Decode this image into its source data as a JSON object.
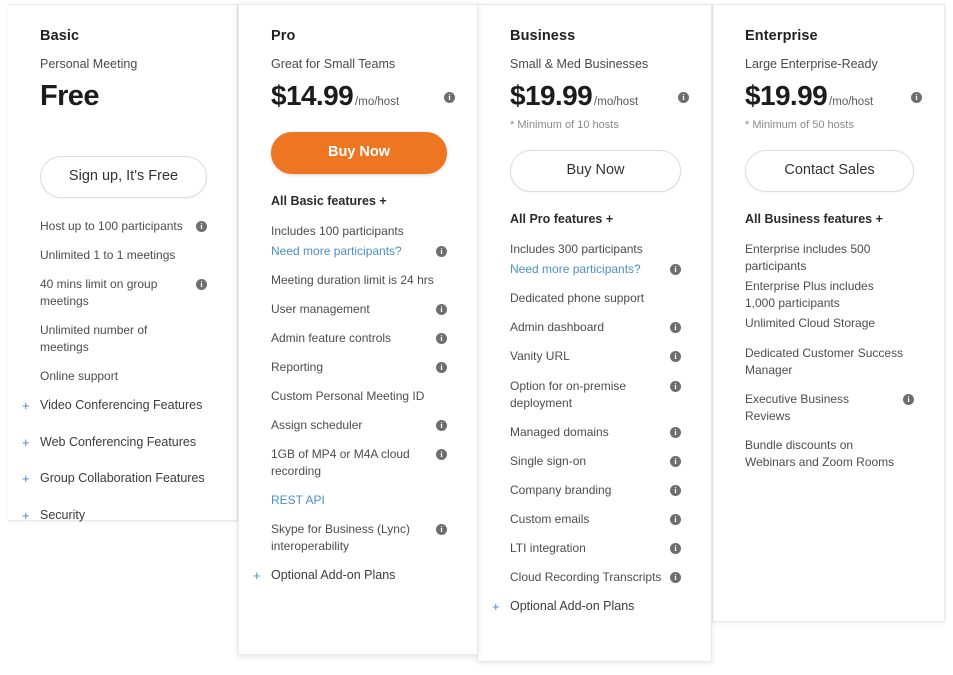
{
  "colors": {
    "accent_orange": "#ee7623",
    "link_blue": "#4c8fc4",
    "plus_blue": "#4a86c8",
    "card_border": "#e9e9e9"
  },
  "icons": {
    "info": "i",
    "plus": "+"
  },
  "plans": [
    {
      "name": "Basic",
      "tagline": "Personal Meeting",
      "price": "Free",
      "price_unit": "",
      "price_note": "",
      "has_price_info": false,
      "cta": {
        "label": "Sign up, It's Free",
        "style": "outline"
      },
      "features_head": "",
      "features": [
        {
          "text": "Host up to 100 participants",
          "info": true
        },
        {
          "text": "Unlimited 1 to 1 meetings",
          "info": false
        },
        {
          "text": "40 mins limit on group meetings",
          "info": true
        },
        {
          "text": "Unlimited number of meetings",
          "info": false
        },
        {
          "text": "Online support",
          "info": false
        }
      ],
      "expanders": [
        "Video Conferencing Features",
        "Web Conferencing Features",
        "Group Collaboration Features",
        "Security"
      ]
    },
    {
      "name": "Pro",
      "tagline": "Great for Small Teams",
      "price": "$14.99",
      "price_unit": "/mo/host",
      "price_note": "",
      "has_price_info": true,
      "cta": {
        "label": "Buy Now",
        "style": "solid"
      },
      "features_head": "All Basic features +",
      "features": [
        {
          "text": "Includes 100 participants",
          "info": false,
          "tight": true
        },
        {
          "text": "Need more participants?",
          "info": true,
          "link": true
        },
        {
          "text": "Meeting duration limit is 24 hrs",
          "info": false
        },
        {
          "text": "User management",
          "info": true
        },
        {
          "text": "Admin feature controls",
          "info": true
        },
        {
          "text": "Reporting",
          "info": true
        },
        {
          "text": "Custom Personal Meeting ID",
          "info": false
        },
        {
          "text": "Assign scheduler",
          "info": true
        },
        {
          "text": "1GB of MP4 or M4A cloud recording",
          "info": true
        },
        {
          "text": "REST API",
          "info": false,
          "link": true
        },
        {
          "text": "Skype for Business (Lync) interoperability",
          "info": true
        }
      ],
      "expanders": [
        "Optional Add-on Plans"
      ]
    },
    {
      "name": "Business",
      "tagline": "Small & Med Businesses",
      "price": "$19.99",
      "price_unit": "/mo/host",
      "price_note": "* Minimum of 10 hosts",
      "has_price_info": true,
      "cta": {
        "label": "Buy Now",
        "style": "outline"
      },
      "features_head": "All Pro features +",
      "features": [
        {
          "text": "Includes 300 participants",
          "info": false,
          "tight": true
        },
        {
          "text": "Need more participants?",
          "info": true,
          "link": true
        },
        {
          "text": "Dedicated phone support",
          "info": false
        },
        {
          "text": "Admin dashboard",
          "info": true
        },
        {
          "text": "Vanity URL",
          "info": true
        },
        {
          "text": "Option for on-premise deployment",
          "info": true
        },
        {
          "text": "Managed domains",
          "info": true
        },
        {
          "text": "Single sign-on",
          "info": true
        },
        {
          "text": "Company branding",
          "info": true
        },
        {
          "text": "Custom emails",
          "info": true
        },
        {
          "text": "LTI integration",
          "info": true
        },
        {
          "text": "Cloud Recording Transcripts",
          "info": true
        }
      ],
      "expanders": [
        "Optional Add-on Plans"
      ]
    },
    {
      "name": "Enterprise",
      "tagline": "Large Enterprise-Ready",
      "price": "$19.99",
      "price_unit": "/mo/host",
      "price_note": "* Minimum of 50 hosts",
      "has_price_info": true,
      "cta": {
        "label": "Contact Sales",
        "style": "outline"
      },
      "features_head": "All Business features +",
      "features": [
        {
          "text": "Enterprise includes 500 participants",
          "info": false,
          "tight": true
        },
        {
          "text": "Enterprise Plus includes 1,000 participants",
          "info": false,
          "tight": true
        },
        {
          "text": "Unlimited Cloud Storage",
          "info": false
        },
        {
          "text": "Dedicated Customer Success Manager",
          "info": false
        },
        {
          "text": "Executive Business Reviews",
          "info": true
        },
        {
          "text": "Bundle discounts on Webinars and Zoom Rooms",
          "info": false
        }
      ],
      "expanders": []
    }
  ]
}
